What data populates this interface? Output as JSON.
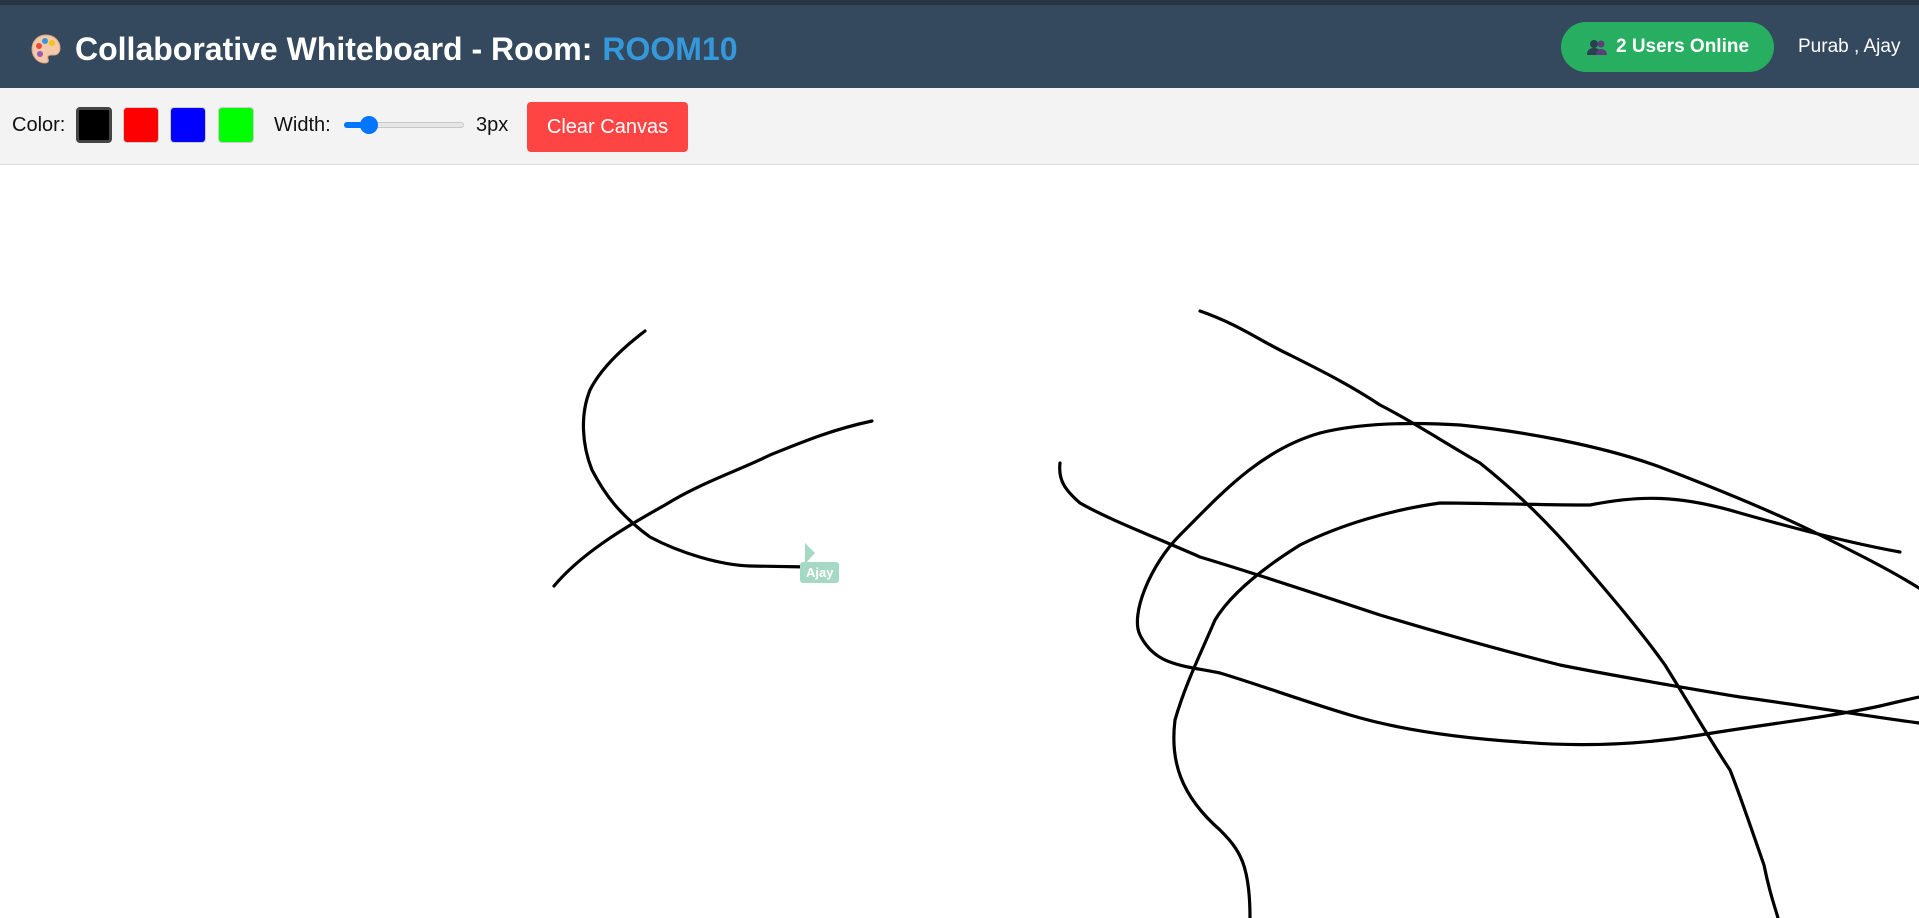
{
  "header": {
    "title_prefix": "Collaborative Whiteboard - Room:",
    "room_code": "ROOM10",
    "users_online_label": "2 Users Online",
    "users_list": "Purab , Ajay",
    "colors": {
      "background": "#34495e",
      "room_code": "#3498db",
      "pill": "#27ae60"
    }
  },
  "toolbar": {
    "color_label": "Color:",
    "swatches": [
      {
        "name": "black",
        "hex": "#000000",
        "selected": true
      },
      {
        "name": "red",
        "hex": "#ff0000",
        "selected": false
      },
      {
        "name": "blue",
        "hex": "#0000ff",
        "selected": false
      },
      {
        "name": "green",
        "hex": "#00ff00",
        "selected": false
      }
    ],
    "width_label": "Width:",
    "width_value": 3,
    "width_min": 1,
    "width_max": 20,
    "width_display": "3px",
    "clear_label": "Clear Canvas",
    "clear_color": "#ff4444"
  },
  "canvas": {
    "stroke_color": "#000000",
    "remote_cursor": {
      "user": "Ajay",
      "color": "#a6d9c5"
    }
  },
  "icons": {
    "title_icon": "palette-icon",
    "users_icon": "users-icon"
  }
}
